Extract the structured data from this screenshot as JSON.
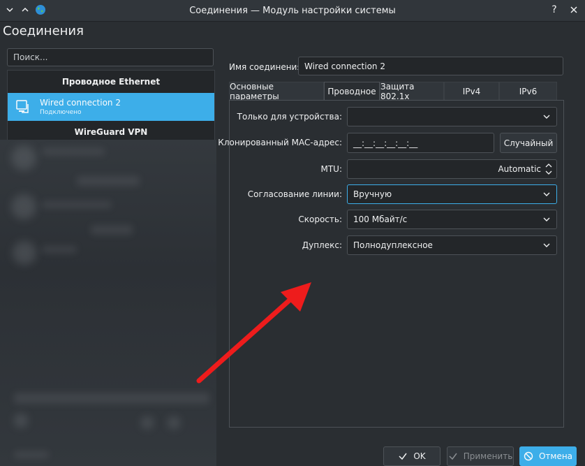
{
  "window": {
    "title": "Соединения — Модуль настройки системы"
  },
  "page_title": "Соединения",
  "search": {
    "placeholder": "Поиск..."
  },
  "connections": {
    "group_ethernet": "Проводное Ethernet",
    "selected": {
      "name": "Wired connection 2",
      "status": "Подключено"
    },
    "group_vpn": "WireGuard VPN"
  },
  "connection_name": {
    "label": "Имя соединения:",
    "value": "Wired connection 2"
  },
  "tabs": [
    {
      "label": "Основные параметры"
    },
    {
      "label": "Проводное"
    },
    {
      "label": "Защита 802.1x"
    },
    {
      "label": "IPv4"
    },
    {
      "label": "IPv6"
    }
  ],
  "wired": {
    "device_label": "Только для устройства:",
    "device_value": "",
    "mac_label": "Клонированный MAC-адрес:",
    "mac_value": "__:__:__:__:__:__",
    "random_button": "Случайный",
    "mtu_label": "MTU:",
    "mtu_value": "Automatic",
    "negotiation_label": "Согласование линии:",
    "negotiation_value": "Вручную",
    "speed_label": "Скорость:",
    "speed_value": "100 Мбайт/с",
    "duplex_label": "Дуплекс:",
    "duplex_value": "Полнодуплексное"
  },
  "buttons": {
    "ok": "OK",
    "apply": "Применить",
    "cancel": "Отмена"
  },
  "colors": {
    "accent": "#3daee9",
    "annotation_arrow": "#ee1c1c"
  }
}
